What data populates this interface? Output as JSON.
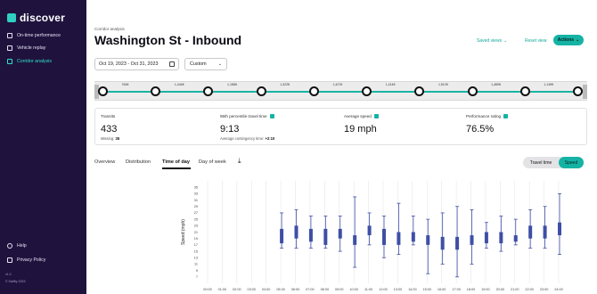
{
  "app": {
    "name": "discover"
  },
  "sidebar": {
    "items": [
      {
        "label": "On-time performance",
        "icon": "calendar-icon",
        "active": false
      },
      {
        "label": "Vehicle replay",
        "icon": "replay-icon",
        "active": false
      },
      {
        "label": "Corridor analysis",
        "icon": "phone-icon",
        "active": true
      }
    ],
    "bottom": [
      {
        "label": "Help",
        "icon": "help-icon"
      },
      {
        "label": "Privacy Policy",
        "icon": "external-link-icon"
      }
    ],
    "footer_version": "v1.0",
    "footer_copyright": "© Swiftly 2023"
  },
  "header": {
    "eyebrow": "Corridor analysis",
    "title": "Washington St - Inbound",
    "saved_views": "Saved views",
    "reset_view": "Reset view",
    "actions": "Actions"
  },
  "filters": {
    "date_range": "Oct 19, 2023 - Oct 31, 2023",
    "mode": "Custom"
  },
  "corridor": {
    "segments": [
      "764ft",
      "1,444ft",
      "1,188ft",
      "1,322ft",
      "1,427ft",
      "1,414ft",
      "1,512ft",
      "1,489ft",
      "1,149ft"
    ]
  },
  "stats": [
    {
      "label": "Transits",
      "value": "433",
      "sub_label": "Missing:",
      "sub_value": "35",
      "info": false
    },
    {
      "label": "95th percentile travel time",
      "value": "9:13",
      "sub_label": "Average contingency time:",
      "sub_value": "+2:10",
      "info": true
    },
    {
      "label": "Average speed",
      "value": "19 mph",
      "sub_label": "",
      "sub_value": "",
      "info": true
    },
    {
      "label": "Performance rating",
      "value": "76.5%",
      "sub_label": "",
      "sub_value": "",
      "info": true
    }
  ],
  "tabs": [
    {
      "label": "Overview",
      "active": false
    },
    {
      "label": "Distribution",
      "active": false
    },
    {
      "label": "Time of day",
      "active": true
    },
    {
      "label": "Day of week",
      "active": false
    }
  ],
  "toggle": {
    "options": [
      "Travel time",
      "Speed"
    ],
    "selected": "Speed"
  },
  "colors": {
    "accent": "#14b3a4",
    "sidebar": "#1f133e",
    "box": "#3f4fa5"
  },
  "chart_data": {
    "type": "box",
    "ylabel": "Speed (mph)",
    "ylim": [
      5,
      37
    ],
    "yticks": [
      7,
      9,
      11,
      13,
      15,
      17,
      19,
      21,
      23,
      25,
      27,
      29,
      31,
      33,
      35
    ],
    "categories": [
      "00:00",
      "01:00",
      "02:00",
      "03:00",
      "04:00",
      "05:00",
      "06:00",
      "07:00",
      "08:00",
      "09:00",
      "10:00",
      "11:00",
      "12:00",
      "13:00",
      "14:00",
      "15:00",
      "16:00",
      "17:00",
      "18:00",
      "19:00",
      "20:00",
      "21:00",
      "22:00",
      "23:00",
      "24:00"
    ],
    "boxes": [
      {
        "x": "05:00",
        "min": 16,
        "q1": 17.5,
        "q3": 22,
        "max": 27
      },
      {
        "x": "06:00",
        "min": 16,
        "q1": 19,
        "q3": 23,
        "max": 28
      },
      {
        "x": "07:00",
        "min": 16,
        "q1": 18,
        "q3": 22,
        "max": 26
      },
      {
        "x": "08:00",
        "min": 16,
        "q1": 17,
        "q3": 22,
        "max": 26
      },
      {
        "x": "09:00",
        "min": 15,
        "q1": 19,
        "q3": 22,
        "max": 26
      },
      {
        "x": "10:00",
        "min": 10,
        "q1": 17,
        "q3": 20,
        "max": 32
      },
      {
        "x": "11:00",
        "min": 17,
        "q1": 20,
        "q3": 23,
        "max": 27
      },
      {
        "x": "12:00",
        "min": 13,
        "q1": 17,
        "q3": 22,
        "max": 26
      },
      {
        "x": "13:00",
        "min": 14,
        "q1": 17,
        "q3": 21,
        "max": 30
      },
      {
        "x": "14:00",
        "min": 17,
        "q1": 18,
        "q3": 21,
        "max": 26
      },
      {
        "x": "15:00",
        "min": 8,
        "q1": 17,
        "q3": 20,
        "max": 25
      },
      {
        "x": "16:00",
        "min": 11,
        "q1": 15.5,
        "q3": 19.5,
        "max": 27
      },
      {
        "x": "17:00",
        "min": 7,
        "q1": 15.5,
        "q3": 19.5,
        "max": 29
      },
      {
        "x": "18:00",
        "min": 11,
        "q1": 17,
        "q3": 20,
        "max": 28
      },
      {
        "x": "19:00",
        "min": 16,
        "q1": 17.5,
        "q3": 21,
        "max": 24
      },
      {
        "x": "20:00",
        "min": 15,
        "q1": 17.5,
        "q3": 21,
        "max": 26
      },
      {
        "x": "21:00",
        "min": 17,
        "q1": 18,
        "q3": 20,
        "max": 25
      },
      {
        "x": "22:00",
        "min": 16,
        "q1": 19,
        "q3": 23,
        "max": 28
      },
      {
        "x": "23:00",
        "min": 16,
        "q1": 19,
        "q3": 23,
        "max": 29
      },
      {
        "x": "24:00",
        "min": 14,
        "q1": 20,
        "q3": 24,
        "max": 33
      }
    ]
  }
}
